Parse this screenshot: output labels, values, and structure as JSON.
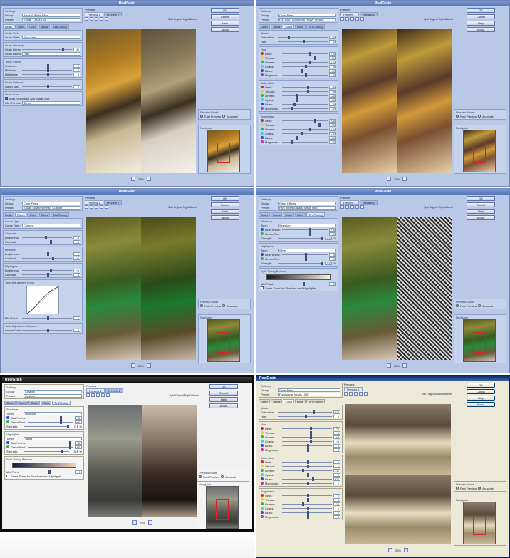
{
  "app_title": "RealGrain",
  "common": {
    "settings_legend": "Settings",
    "group_label": "Group:",
    "preset_label": "Preset:",
    "preview_legend": "Preview",
    "preview_tab1": "Preview 1",
    "preview_tab2": "Preview 2",
    "split_label": "Split Original Right/Altered",
    "split_label_w6": "Top Original/Bottom Altered",
    "zoom": "25%",
    "preview_mode_legend": "Preview Mode",
    "fast_preview": "Fast Preview",
    "accurate": "Accurate",
    "navigator_legend": "Navigator",
    "ok": "OK",
    "cancel": "Cancel",
    "help": "Help",
    "about": "About",
    "tabs": [
      "Grain",
      "Tones",
      "Color",
      "Blurs",
      "Tint/Toning"
    ]
  },
  "windows": [
    {
      "group": "Black & White Films",
      "preset": "Kodak T-Max 100",
      "sel_tab": 0,
      "sections": [
        {
          "legend": "Grain Style",
          "rows": [
            {
              "label": "Grain Style:",
              "field": "Film Grain"
            }
          ]
        },
        {
          "legend": "Grain Intensity",
          "rows": [
            {
              "label": "Grain Intensity",
              "value": "30"
            },
            {
              "label": "Grain Density:",
              "field": "High"
            }
          ]
        },
        {
          "legend": "Tonal Range",
          "rows": [
            {
              "label": "Shadows",
              "value": "0"
            },
            {
              "label": "Midtones",
              "value": "0"
            },
            {
              "label": "Highlights",
              "value": "0"
            }
          ]
        },
        {
          "legend": "Grain Balance",
          "rows": [
            {
              "label": "Dark/Light:",
              "value": "0"
            }
          ]
        },
        {
          "legend": "Grain Size",
          "rows": [
            {
              "label": "Auto Resolution and Image Blur",
              "check": true
            },
            {
              "label": "Film Format:",
              "field": "35mm"
            }
          ]
        }
      ]
    },
    {
      "group": "Color Films",
      "preset": "Fuji 400H Lightroom Heavy Texture",
      "sel_tab": 2,
      "sections": [
        {
          "legend": "Master",
          "rows": [
            {
              "label": "Saturation:",
              "value": "-30"
            },
            {
              "label": "Hue:",
              "value": "0"
            }
          ]
        },
        {
          "legend": "Hue",
          "rows": [
            {
              "label": "Reds:",
              "value": "+10",
              "dot": "#d62a2a"
            },
            {
              "label": "Yellows:",
              "value": "+20",
              "dot": "#e8d32a"
            },
            {
              "label": "Greens:",
              "value": "+10",
              "dot": "#2ab84a"
            },
            {
              "label": "Cyans:",
              "value": "0",
              "dot": "#2ad8e8"
            },
            {
              "label": "Blues:",
              "value": "-10",
              "dot": "#2a4ad8"
            },
            {
              "label": "Magentas:",
              "value": "0",
              "dot": "#c82ac8"
            }
          ]
        },
        {
          "legend": "Saturation",
          "rows": [
            {
              "label": "Reds:",
              "value": "+5",
              "dot": "#d62a2a"
            },
            {
              "label": "Yellows:",
              "value": "+5",
              "dot": "#e8d32a"
            },
            {
              "label": "Greens:",
              "value": "-20",
              "dot": "#2ab84a"
            },
            {
              "label": "Cyans:",
              "value": "-20",
              "dot": "#2ad8e8"
            },
            {
              "label": "Blues:",
              "value": "-25",
              "dot": "#2a4ad8"
            },
            {
              "label": "Magentas:",
              "value": "-30",
              "dot": "#c82ac8"
            }
          ]
        },
        {
          "legend": "Brightness",
          "rows": [
            {
              "label": "Reds:",
              "value": "+20",
              "dot": "#d62a2a"
            },
            {
              "label": "Yellows:",
              "value": "+30",
              "dot": "#e8d32a"
            },
            {
              "label": "Greens:",
              "value": "+10",
              "dot": "#2ab84a"
            },
            {
              "label": "Cyans:",
              "value": "-10",
              "dot": "#2ad8e8"
            },
            {
              "label": "Blues:",
              "value": "-20",
              "dot": "#2a4ad8"
            },
            {
              "label": "Magentas:",
              "value": "-30",
              "dot": "#c82ac8"
            }
          ]
        }
      ]
    },
    {
      "group": "Color Films",
      "preset": "Kodak Ektachrome 64 Custom",
      "sel_tab": 1,
      "sections": [
        {
          "legend": "Curve Type",
          "rows": [
            {
              "label": "Curve Type:",
              "field": "Custom"
            }
          ]
        },
        {
          "legend": "Shadows",
          "rows": [
            {
              "label": "Brightness:",
              "value": "-5"
            },
            {
              "label": "Contrast:",
              "value": "+5"
            }
          ]
        },
        {
          "legend": "Midtones",
          "rows": [
            {
              "label": "Brightness:",
              "value": "0"
            },
            {
              "label": "Contrast:",
              "value": "+10"
            }
          ]
        },
        {
          "legend": "Highlights",
          "rows": [
            {
              "label": "Brightness:",
              "value": "+5"
            },
            {
              "label": "Contrast:",
              "value": "0"
            }
          ]
        },
        {
          "legend": "Tone Adjustment Curve",
          "curve": true,
          "rows": [
            {
              "label": "Mid Point:",
              "value": "0"
            }
          ]
        },
        {
          "legend": "Tone Adjustment Balance",
          "rows": [
            {
              "label": "Lemon/Green:",
              "value": "0"
            }
          ]
        }
      ]
    },
    {
      "group": "Other Effects",
      "preset": "Film Infrared Black Sepia Ilford",
      "sel_tab": 4,
      "sections": [
        {
          "legend": "Shadows",
          "rows": [
            {
              "label": "Tone:",
              "field": "Selenium"
            },
            {
              "label": "Blue/Yellow:",
              "value": "+10",
              "dot": "#2a4ad8"
            },
            {
              "label": "Green/Red:",
              "value": "+10",
              "dot": "#2ab84a"
            },
            {
              "label": "Strength:",
              "value": "100",
              "unit": "%"
            }
          ]
        },
        {
          "legend": "Highlights",
          "rows": [
            {
              "label": "Tone:",
              "field": "Silver"
            },
            {
              "label": "Blue/Yellow:",
              "value": "0",
              "dot": "#2a4ad8"
            },
            {
              "label": "Green/Red:",
              "value": "0",
              "dot": "#2ab84a"
            },
            {
              "label": "Strength:",
              "value": "100",
              "unit": "%"
            }
          ]
        },
        {
          "legend": "Split Toning Balance",
          "grad": "linear-gradient(90deg,#1a1a1a,#f2f0e2)",
          "rows": [
            {
              "label": "Mid Point:",
              "value": "0"
            },
            {
              "label": "Same Toner for Shadows and Highlights",
              "check": false
            }
          ]
        }
      ]
    },
    {
      "group": "Custom",
      "preset": "Custom",
      "sel_tab": 4,
      "sections": [
        {
          "legend": "Shadows",
          "rows": [
            {
              "label": "Toner:",
              "field": "Duotone"
            },
            {
              "label": "Blue/Yellow:",
              "value": "+20",
              "dot": "#2a4ad8"
            },
            {
              "label": "Green/Red:",
              "value": "+20",
              "dot": "#2ab84a"
            },
            {
              "label": "Strength:",
              "value": "75",
              "unit": "%"
            }
          ]
        },
        {
          "legend": "Highlights",
          "rows": [
            {
              "label": "Toner:",
              "field": "Sepia"
            },
            {
              "label": "Blue/Yellow:",
              "value": "+40",
              "dot": "#2a4ad8"
            },
            {
              "label": "Green/Red:",
              "value": "+40",
              "dot": "#2ab84a"
            },
            {
              "label": "Strength:",
              "value": "30",
              "unit": "%"
            }
          ]
        },
        {
          "legend": "Split Toning Balance",
          "grad": "linear-gradient(90deg,#0e1d3a,#f0d2b8)",
          "rows": [
            {
              "label": "Mid Point:",
              "value": "0"
            },
            {
              "label": "Same Toner for Shadows and Highlights",
              "check": false
            }
          ]
        }
      ]
    },
    {
      "group": "Color Films",
      "preset": "Fujichrome Velvia 100F",
      "sel_tab": 2,
      "sections": [
        {
          "legend": "Master",
          "rows": [
            {
              "label": "Saturation:",
              "value": "+15"
            },
            {
              "label": "Hue:",
              "value": "0"
            }
          ]
        },
        {
          "legend": "Hue",
          "rows": [
            {
              "label": "Reds:",
              "value": "+5",
              "dot": "#d62a2a"
            },
            {
              "label": "Yellows:",
              "value": "+5",
              "dot": "#e8d32a"
            },
            {
              "label": "Greens:",
              "value": "+5",
              "dot": "#2ab84a"
            },
            {
              "label": "Cyans:",
              "value": "+5",
              "dot": "#2ad8e8"
            },
            {
              "label": "Blues:",
              "value": "0",
              "dot": "#2a4ad8"
            },
            {
              "label": "Magentas:",
              "value": "0",
              "dot": "#c82ac8"
            }
          ]
        },
        {
          "legend": "Saturation",
          "rows": [
            {
              "label": "Reds:",
              "value": "0",
              "dot": "#d62a2a"
            },
            {
              "label": "Yellows:",
              "value": "0",
              "dot": "#e8d32a"
            },
            {
              "label": "Greens:",
              "value": "-10",
              "dot": "#2ab84a"
            },
            {
              "label": "Cyans:",
              "value": "0",
              "dot": "#2ad8e8"
            },
            {
              "label": "Blues:",
              "value": "+10",
              "dot": "#2a4ad8"
            },
            {
              "label": "Magentas:",
              "value": "0",
              "dot": "#c82ac8"
            }
          ]
        },
        {
          "legend": "Brightness",
          "rows": [
            {
              "label": "Reds:",
              "value": "0",
              "dot": "#d62a2a"
            },
            {
              "label": "Yellows:",
              "value": "0",
              "dot": "#e8d32a"
            },
            {
              "label": "Greens:",
              "value": "-10",
              "dot": "#2ab84a"
            },
            {
              "label": "Cyans:",
              "value": "0",
              "dot": "#2ad8e8"
            },
            {
              "label": "Blues:",
              "value": "0",
              "dot": "#2a4ad8"
            },
            {
              "label": "Magentas:",
              "value": "0",
              "dot": "#c82ac8"
            }
          ]
        }
      ]
    }
  ]
}
